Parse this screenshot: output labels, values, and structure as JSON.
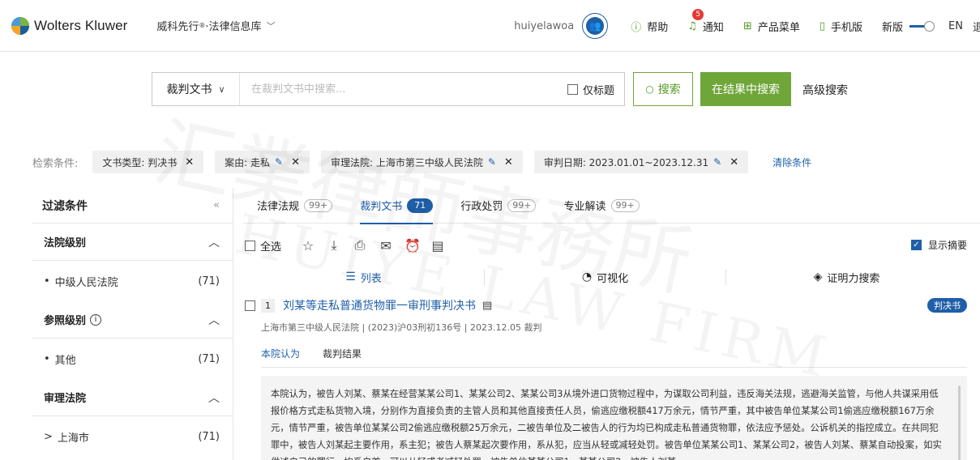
{
  "header": {
    "brand": "Wolters Kluwer",
    "product": "威科先行",
    "product_mark": "®",
    "product_suffix": "·法律信息库",
    "username": "huiyelawoa",
    "nav": [
      {
        "icon": "help-icon",
        "label": "帮助"
      },
      {
        "icon": "bell-icon",
        "label": "通知",
        "badge": "5"
      },
      {
        "icon": "grid-icon",
        "label": "产品菜单"
      },
      {
        "icon": "mobile-icon",
        "label": "手机版"
      }
    ],
    "new_version_label": "新版",
    "lang": "EN",
    "logout": "退"
  },
  "search": {
    "doc_type": "裁判文书",
    "placeholder": "在裁判文书中搜索...",
    "title_only": "仅标题",
    "search_btn": "搜索",
    "in_results_btn": "在结果中搜索",
    "advanced": "高级搜索"
  },
  "conditions": {
    "label": "检索条件:",
    "chips": [
      {
        "text": "文书类型: 判决书",
        "editable": false
      },
      {
        "text": "案由: 走私",
        "editable": true
      },
      {
        "text": "审理法院: 上海市第三中级人民法院",
        "editable": true
      },
      {
        "text": "审判日期: 2023.01.01~2023.12.31",
        "editable": true
      }
    ],
    "clear": "清除条件"
  },
  "sidebar": {
    "title": "过滤条件",
    "sections": [
      {
        "title": "法院级别",
        "info": false,
        "items": [
          {
            "label": "中级人民法院",
            "count": "(71)",
            "prefix": "•"
          }
        ]
      },
      {
        "title": "参照级别",
        "info": true,
        "items": [
          {
            "label": "其他",
            "count": "(71)",
            "prefix": "•"
          }
        ]
      },
      {
        "title": "审理法院",
        "info": false,
        "items": [
          {
            "label": "上海市",
            "count": "(71)",
            "prefix": ">"
          }
        ]
      }
    ]
  },
  "tabs": [
    {
      "label": "法律法规",
      "count": "99+",
      "active": false
    },
    {
      "label": "裁判文书",
      "count": "71",
      "active": true
    },
    {
      "label": "行政处罚",
      "count": "99+",
      "active": false
    },
    {
      "label": "专业解读",
      "count": "99+",
      "active": false
    }
  ],
  "toolbar": {
    "select_all": "全选",
    "show_summary": "显示摘要"
  },
  "views": [
    {
      "icon": "list-icon",
      "label": "列表",
      "active": true
    },
    {
      "icon": "chart-icon",
      "label": "可视化",
      "active": false
    },
    {
      "icon": "layers-icon",
      "label": "证明力搜索",
      "active": false
    }
  ],
  "result": {
    "num": "1",
    "title": "刘某等走私普通货物罪一审刑事判决书",
    "type_badge": "判决书",
    "meta": "上海市第三中级人民法院  |  (2023)沪03刑初136号  |  2023.12.05 裁判",
    "sub_tabs": [
      "本院认为",
      "裁判结果"
    ],
    "excerpt": "本院认为，被告人刘某、蔡某在经营某某公司1、某某公司2、某某公司3从境外进口货物过程中，为谋取公司利益，违反海关法规，逃避海关监管，与他人共谋采用低报价格方式走私货物入境，分别作为直接负责的主管人员和其他直接责任人员，偷逃应缴税额417万余元，情节严重，其中被告单位某某公司1偷逃应缴税额167万余元，情节严重，被告单位某某公司2偷逃应缴税额25万余元，二被告单位及二被告人的行为均已构成走私普通货物罪，依法应予惩处。公诉机关的指控成立。在共同犯罪中，被告人刘某起主要作用，系主犯；被告人蔡某起次要作用，系从犯，应当从轻或减轻处罚。被告单位某某公司1、某某公司2，被告人刘某、蔡某自动投案，如实供述自己的罪行，均系自首，可以从轻或者减轻处罚。被告单位某某公司1、某某公司2，被告人刘某"
  },
  "watermark": {
    "cn": "汇業律師事務所",
    "en": "HUIYE LAW FIRM"
  },
  "colors": {
    "brand_blue": "#1f5fa8",
    "brand_green": "#6fa63a",
    "alert_red": "#e53935"
  }
}
